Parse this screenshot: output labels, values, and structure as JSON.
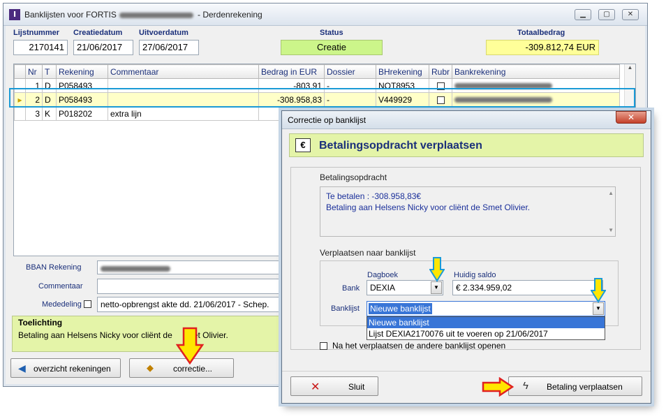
{
  "main": {
    "title_prefix": "Banklijsten voor FORTIS",
    "title_suffix": "- Derdenrekening",
    "header": {
      "lijstnummer_label": "Lijstnummer",
      "creatiedatum_label": "Creatiedatum",
      "uitvoerdatum_label": "Uitvoerdatum",
      "status_label": "Status",
      "totaalbedrag_label": "Totaalbedrag",
      "lijstnummer": "2170141",
      "creatiedatum": "21/06/2017",
      "uitvoerdatum": "27/06/2017",
      "status": "Creatie",
      "totaalbedrag": "-309.812,74  EUR"
    },
    "table": {
      "columns": [
        "Nr",
        "T",
        "Rekening",
        "Commentaar",
        "Bedrag in EUR",
        "Dossier",
        "BHrekening",
        "Rubr",
        "Bankrekening"
      ],
      "rows": [
        {
          "nr": "1",
          "t": "D",
          "rekening": "P058493",
          "commentaar": "",
          "bedrag": "-803,91",
          "dossier": "-",
          "bh": "NOT8953"
        },
        {
          "nr": "2",
          "t": "D",
          "rekening": "P058493",
          "commentaar": "",
          "bedrag": "-308.958,83",
          "dossier": "-",
          "bh": "V449929"
        },
        {
          "nr": "3",
          "t": "K",
          "rekening": "P018202",
          "commentaar": "extra lijn",
          "bedrag": "",
          "dossier": "",
          "bh": ""
        }
      ]
    },
    "bban_label": "BBAN Rekening",
    "commentaar_label": "Commentaar",
    "mededeling_label": "Mededeling",
    "mededeling_value": "netto-opbrengst akte dd. 21/06/2017 - Schep.",
    "toelichting_title": "Toelichting",
    "toelichting_text_a": "Betaling aan Helsens Nicky voor cliënt de",
    "toelichting_text_b": "et Olivier.",
    "btn_overzicht": "overzicht rekeningen",
    "btn_correctie": "correctie..."
  },
  "dialog": {
    "title": "Correctie op banklijst",
    "header": "Betalingsopdracht verplaatsen",
    "betalingsopdracht_label": "Betalingsopdracht",
    "betaal_line1": "Te betalen : -308.958,83€",
    "betaal_line2": "Betaling aan Helsens Nicky voor cliënt de Smet Olivier.",
    "verplaatsen_label": "Verplaatsen naar banklijst",
    "dagboek_label": "Dagboek",
    "huidig_saldo_label": "Huidig saldo",
    "bank_label": "Bank",
    "bank_value": "DEXIA",
    "saldo_value": "€ 2.334.959,02",
    "banklijst_label": "Banklijst",
    "banklijst_value": "Nieuwe banklijst",
    "options": [
      "Nieuwe banklijst",
      "Lijst DEXIA2170076 uit te voeren op 21/06/2017"
    ],
    "open_checkbox_label": "Na het verplaatsen de andere banklijst openen",
    "btn_sluit": "Sluit",
    "btn_verplaatsen": "Betaling verplaatsen"
  },
  "colors": {
    "status_green": "#ccf58a",
    "total_yellow": "#ffff99",
    "selected_row": "#ffffc8",
    "highlight_frame": "#1a9ad6",
    "arrow_yellow": "#ffe600",
    "arrow_red": "#e02020"
  }
}
